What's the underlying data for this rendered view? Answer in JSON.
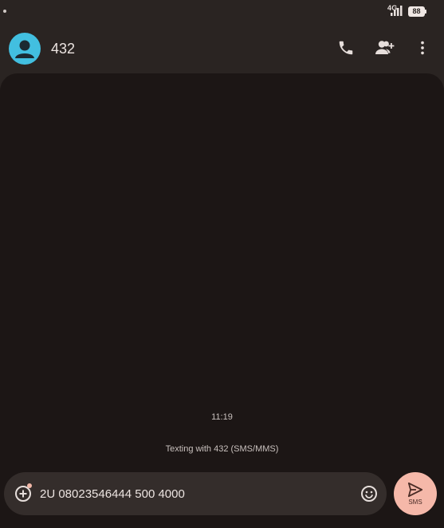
{
  "status_bar": {
    "network": "4G",
    "battery": "88"
  },
  "header": {
    "contact_name": "432",
    "icons": [
      "person-icon",
      "phone-icon",
      "add-contact-icon",
      "more-vert-icon"
    ]
  },
  "conversation": {
    "timestamp": "11:19",
    "texting_with": "Texting with 432 (SMS/MMS)"
  },
  "composer": {
    "message_value": "2U 08023546444 500 4000",
    "send_label": "SMS",
    "icons": [
      "add-attachment-icon",
      "emoji-icon",
      "send-icon"
    ]
  },
  "colors": {
    "background": "#2a2422",
    "panel": "#1c1615",
    "avatar": "#42bfe0",
    "send_button": "#f5b8a9",
    "composer_field": "#342d2b"
  }
}
